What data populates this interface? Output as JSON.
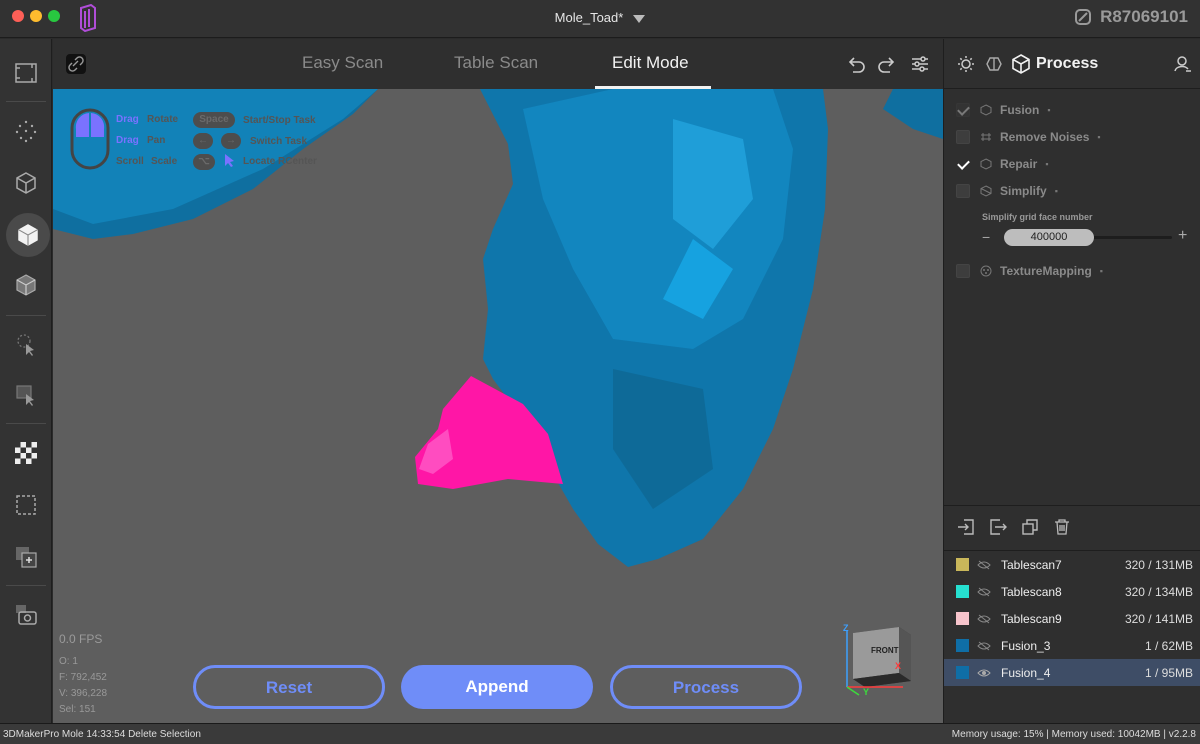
{
  "window": {
    "title": "Mole_Toad*",
    "device_id": "R87069101"
  },
  "tabs": [
    {
      "label": "Easy Scan",
      "active": false
    },
    {
      "label": "Table Scan",
      "active": false
    },
    {
      "label": "Edit Mode",
      "active": true
    }
  ],
  "hints": {
    "drag1": "Drag",
    "rotate": "Rotate",
    "drag2": "Drag",
    "pan": "Pan",
    "scroll": "Scroll",
    "scale": "Scale",
    "space": "Space",
    "start_stop": "Start/Stop Task",
    "switch": "Switch Task",
    "locate": "Locate RCenter",
    "alt_key": "⌥"
  },
  "viewport": {
    "fps": "0.0 FPS",
    "stats": [
      "O: 1",
      "F: 792,452",
      "V: 396,228",
      "Sel: 151"
    ],
    "gizmo_label": "FRONT",
    "axis_z": "Z",
    "axis_x": "X",
    "axis_y": "Y"
  },
  "actions": {
    "reset": "Reset",
    "append": "Append",
    "process": "Process"
  },
  "process_panel": {
    "title": "Process",
    "items": [
      {
        "label": "Fusion",
        "checked": true,
        "enabled": false
      },
      {
        "label": "Remove Noises",
        "checked": false,
        "enabled": false
      },
      {
        "label": "Repair",
        "checked": true,
        "enabled": true
      },
      {
        "label": "Simplify",
        "checked": false,
        "enabled": false
      },
      {
        "label": "TextureMapping",
        "checked": false,
        "enabled": false
      }
    ],
    "simplify_label": "Simplify grid face number",
    "simplify_value": "400000",
    "minus": "−",
    "plus": "+"
  },
  "scans": [
    {
      "name": "Tablescan7",
      "size": "320 / 131MB",
      "color": "#c9b75a",
      "visible": false,
      "selected": false
    },
    {
      "name": "Tablescan8",
      "size": "320 / 134MB",
      "color": "#26e0d0",
      "visible": false,
      "selected": false
    },
    {
      "name": "Tablescan9",
      "size": "320 / 141MB",
      "color": "#f7c4cc",
      "visible": false,
      "selected": false
    },
    {
      "name": "Fusion_3",
      "size": "1 / 62MB",
      "color": "#0f6ea6",
      "visible": false,
      "selected": false
    },
    {
      "name": "Fusion_4",
      "size": "1 / 95MB",
      "color": "#0f6ea6",
      "visible": true,
      "selected": true
    }
  ],
  "status": {
    "left": "3DMakerPro Mole   14:33:54 Delete Selection",
    "right": "Memory usage: 15% | Memory used: 10042MB | v2.2.8"
  },
  "colors": {
    "accent": "#6f8df8",
    "mesh": "#0f7db0",
    "selection": "#ff1aa8"
  }
}
